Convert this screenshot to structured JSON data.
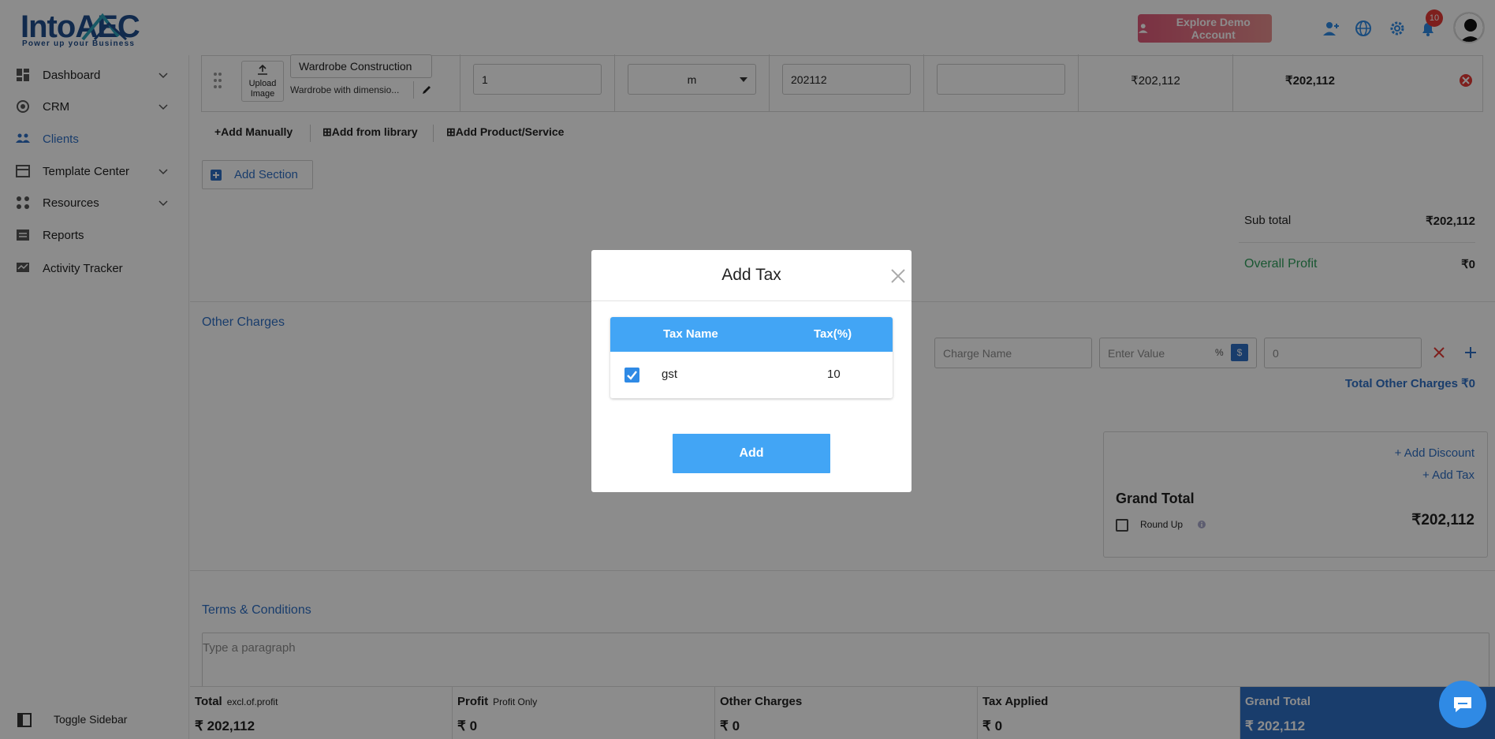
{
  "brand": {
    "name": "IntoAEC",
    "tagline": "Power up your Business"
  },
  "topbar": {
    "demo_label": "Explore Demo Account",
    "notification_count": "10"
  },
  "sidebar": {
    "items": [
      {
        "label": "Dashboard",
        "icon": "dashboard-icon",
        "has_submenu": true
      },
      {
        "label": "CRM",
        "icon": "crm-icon",
        "has_submenu": true
      },
      {
        "label": "Clients",
        "icon": "clients-icon",
        "has_submenu": false,
        "active": true
      },
      {
        "label": "Template Center",
        "icon": "template-icon",
        "has_submenu": true
      },
      {
        "label": "Resources",
        "icon": "resources-icon",
        "has_submenu": true
      },
      {
        "label": "Reports",
        "icon": "reports-icon",
        "has_submenu": false
      },
      {
        "label": "Activity Tracker",
        "icon": "activity-icon",
        "has_submenu": false
      }
    ],
    "toggle_label": "Toggle Sidebar"
  },
  "item_row": {
    "upload_label_1": "Upload",
    "upload_label_2": "Image",
    "name": "Wardrobe Construction",
    "description": "Wardrobe with dimensio...",
    "quantity": "1",
    "unit": "m",
    "rate": "202112",
    "extra": "",
    "amount": "₹202,112",
    "total": "₹202,112"
  },
  "actions": {
    "add_manually": "+Add Manually",
    "add_from_library": "Add from library",
    "add_product": "Add Product/Service",
    "add_section": "Add Section"
  },
  "summary": {
    "subtotal_label": "Sub total",
    "subtotal_value": "₹202,112",
    "profit_label": "Overall Profit",
    "profit_value": "₹0"
  },
  "other_charges": {
    "title": "Other Charges",
    "charge_name_placeholder": "Charge Name",
    "value_placeholder": "Enter Value",
    "percent_label": "%",
    "dollar_label": "$",
    "amount_placeholder": "0",
    "total_label": "Total Other Charges ₹0"
  },
  "grand_total_box": {
    "add_discount": "+ Add Discount",
    "add_tax": "+ Add Tax",
    "title": "Grand Total",
    "round_up": "Round Up",
    "value": "₹202,112"
  },
  "terms": {
    "title": "Terms & Conditions",
    "placeholder": "Type a paragraph"
  },
  "footer": {
    "total_label": "Total",
    "total_sub": "excl.of.profit",
    "total_value": "202,112",
    "profit_label": "Profit",
    "profit_sub": "Profit Only",
    "profit_value": "0",
    "other_label": "Other Charges",
    "other_value": "0",
    "tax_label": "Tax Applied",
    "tax_value": "0",
    "grand_label": "Grand Total",
    "grand_value": "202,112",
    "currency": "₹"
  },
  "modal": {
    "title": "Add Tax",
    "col_name": "Tax Name",
    "col_pct": "Tax(%)",
    "rows": [
      {
        "name": "gst",
        "pct": "10",
        "checked": true
      }
    ],
    "add_button": "Add"
  },
  "colors": {
    "accent": "#2f6fc5",
    "modal_header": "#42a5f5",
    "profit_green": "#2e9e5b",
    "danger": "#e53935"
  }
}
